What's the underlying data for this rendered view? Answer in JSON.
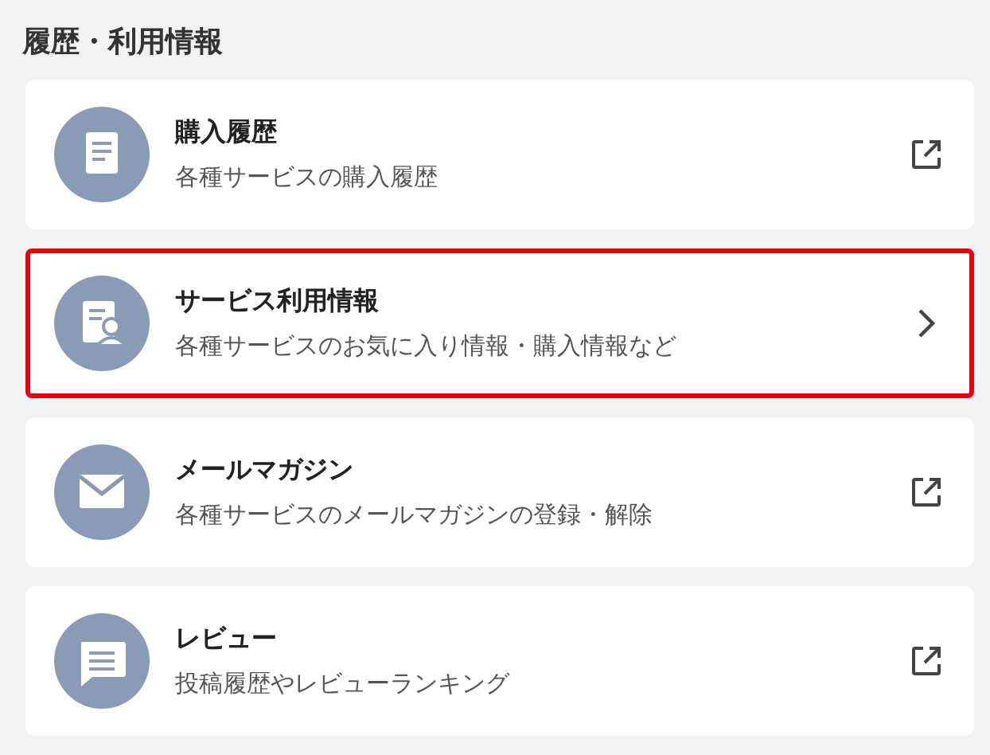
{
  "section": {
    "title": "履歴・利用情報"
  },
  "items": [
    {
      "title": "購入履歴",
      "subtitle": "各種サービスの購入履歴",
      "kind": "external",
      "highlighted": false
    },
    {
      "title": "サービス利用情報",
      "subtitle": "各種サービスのお気に入り情報・購入情報など",
      "kind": "internal",
      "highlighted": true
    },
    {
      "title": "メールマガジン",
      "subtitle": "各種サービスのメールマガジンの登録・解除",
      "kind": "external",
      "highlighted": false
    },
    {
      "title": "レビュー",
      "subtitle": "投稿履歴やレビューランキング",
      "kind": "external",
      "highlighted": false
    }
  ]
}
